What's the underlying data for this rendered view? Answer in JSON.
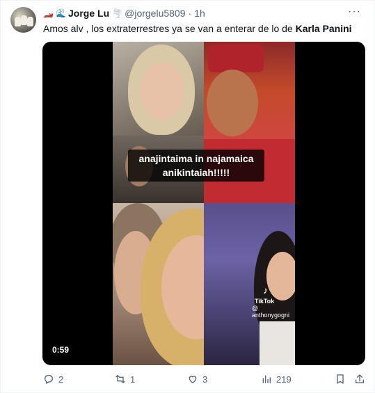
{
  "tweet": {
    "author_emojis": [
      "🏎️",
      "🌊"
    ],
    "author_name": "Jorge Lu",
    "author_suffix_emoji": "🌪️",
    "handle": "@jorgelu5809",
    "separator": "·",
    "time": "1h",
    "more_label": "···",
    "text_prefix": "Amos alv , los extraterrestres ya se van a enterar de lo de ",
    "text_bold": "Karla Panini"
  },
  "media": {
    "caption_line1": "anajintaima in najamaica",
    "caption_line2": "anikintaiah!!!!!",
    "tiktok_icon": "♪",
    "tiktok_brand": "TikTok",
    "tiktok_user": "@ anthonygogni",
    "duration": "0:59"
  },
  "actions": {
    "reply_count": "2",
    "retweet_count": "1",
    "like_count": "3",
    "views_count": "219"
  },
  "icons": {
    "reply": "reply-icon",
    "retweet": "retweet-icon",
    "like": "heart-icon",
    "views": "views-icon",
    "bookmark": "bookmark-icon",
    "share": "share-icon"
  },
  "colors": {
    "text_primary": "#0f1419",
    "text_secondary": "#536471"
  }
}
